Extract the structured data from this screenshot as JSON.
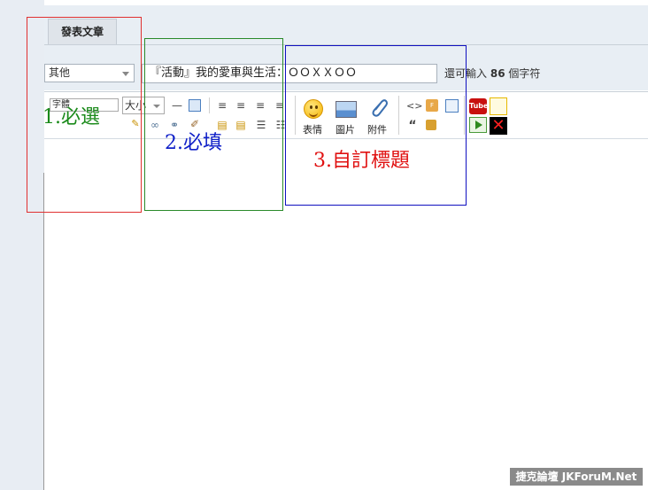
{
  "tab": {
    "label": "發表文章"
  },
  "category_select": {
    "value": "其他"
  },
  "title_input": {
    "value": "『活動』我的愛車與生活：ＯＯＸＸＯＯ"
  },
  "counter": {
    "prefix": "還可輸入",
    "number": "86",
    "suffix": "個字符"
  },
  "toolbar": {
    "font_label": "字體",
    "size_label": "大小",
    "smiley_label": "表情",
    "image_label": "圖片",
    "attach_label": "附件",
    "youtube_label": "Tube"
  },
  "annotations": [
    {
      "text": "1.必選",
      "color": "#1a8a1a"
    },
    {
      "text": "2.必填",
      "color": "#1020c8"
    },
    {
      "text": "3.自訂標題",
      "color": "#e01010"
    }
  ],
  "annotation_box_colors": [
    "#e03030",
    "#2a8a2a",
    "#1010c0"
  ],
  "watermark": "捷克論壇 JKForuM.Net"
}
